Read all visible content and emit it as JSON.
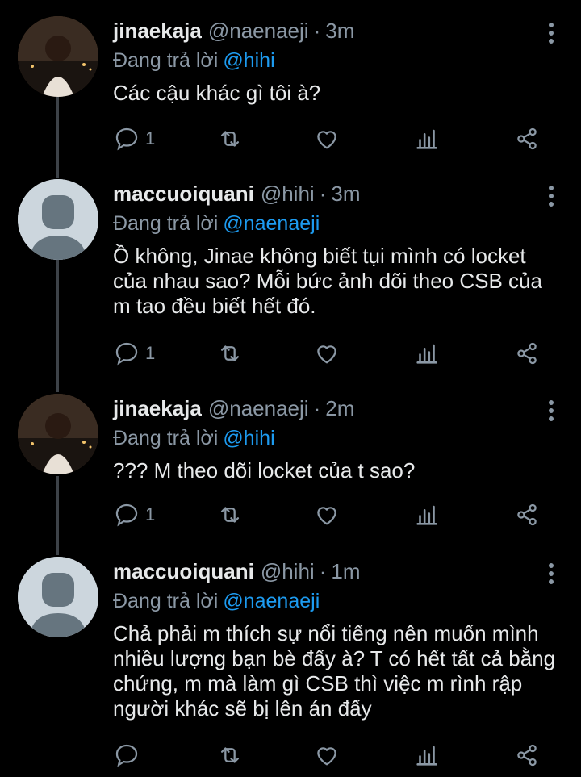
{
  "tweets": [
    {
      "name": "jinaekaja",
      "handle": "@naenaeji",
      "separator": "·",
      "time": "3m",
      "reply_prefix": "Đang trả lời",
      "reply_to": "@hihi",
      "text": "Các cậu khác gì tôi à?",
      "reply_count": "1",
      "avatar": "photo"
    },
    {
      "name": "maccuoiquani",
      "handle": "@hihi",
      "separator": "·",
      "time": "3m",
      "reply_prefix": "Đang trả lời",
      "reply_to": "@naenaeji",
      "text": "Ồ không, Jinae không biết tụi mình có locket của nhau sao? Mỗi bức ảnh dõi theo CSB của m tao đều biết hết đó.",
      "reply_count": "1",
      "avatar": "default"
    },
    {
      "name": "jinaekaja",
      "handle": "@naenaeji",
      "separator": "·",
      "time": "2m",
      "reply_prefix": "Đang trả lời",
      "reply_to": "@hihi",
      "text": "??? M theo dõi locket của t sao?",
      "reply_count": "1",
      "avatar": "photo"
    },
    {
      "name": "maccuoiquani",
      "handle": "@hihi",
      "separator": "·",
      "time": "1m",
      "reply_prefix": "Đang trả lời",
      "reply_to": "@naenaeji",
      "text": "Chả phải m thích sự nổi tiếng nên muốn mình nhiều lượng bạn bè đấy à? T có hết tất cả bằng chứng, m mà làm gì CSB thì việc m rình rập người khác sẽ bị lên án đấy",
      "reply_count": "",
      "avatar": "default"
    }
  ],
  "colors": {
    "background": "#000000",
    "name": "#e7e9ea",
    "secondary": "#8b98a5",
    "mention": "#1d9bf0",
    "thread_line": "#3d4248"
  },
  "icons": [
    "reply-icon",
    "retweet-icon",
    "like-icon",
    "analytics-icon",
    "share-icon",
    "more-icon"
  ]
}
